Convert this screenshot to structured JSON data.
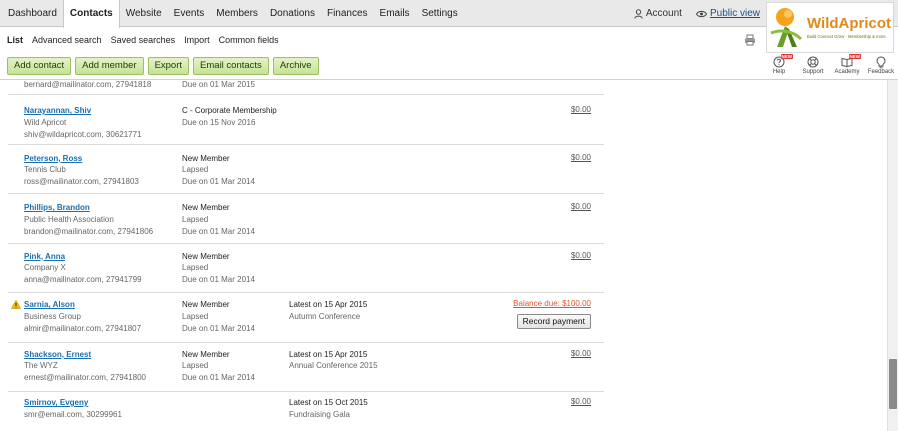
{
  "nav": {
    "tabs": [
      "Dashboard",
      "Contacts",
      "Website",
      "Events",
      "Members",
      "Donations",
      "Finances",
      "Emails",
      "Settings"
    ],
    "active_tab": "Contacts",
    "account_label": "Account",
    "public_view_label": "Public view"
  },
  "subnav": {
    "items": [
      "List",
      "Advanced search",
      "Saved searches",
      "Import",
      "Common fields"
    ],
    "active": "List"
  },
  "toolbar": {
    "buttons": [
      "Add contact",
      "Add member",
      "Export",
      "Email contacts",
      "Archive"
    ]
  },
  "logo": {
    "brand": "WildApricot",
    "tagline": "Build Connect Grow · Membership & more"
  },
  "help": {
    "items": [
      {
        "label": "Help",
        "icon": "help-icon",
        "new": true,
        "new_label": "NEW"
      },
      {
        "label": "Support",
        "icon": "support-icon",
        "new": false
      },
      {
        "label": "Academy",
        "icon": "academy-icon",
        "new": true,
        "new_label": "NEW"
      },
      {
        "label": "Feedback",
        "icon": "feedback-icon",
        "new": false
      }
    ]
  },
  "contacts": {
    "partial_row": {
      "line": "bernard@mailinator.com, 27941818",
      "due": "Due on 01 Mar 2015"
    },
    "rows": [
      {
        "name": "Narayannan, Shiv",
        "org": "Wild Apricot",
        "contact": "shiv@wildapricot.com, 30621771",
        "level": "C - Corporate Membership",
        "status": "",
        "due": "Due on 15 Nov 2016",
        "event_date": "",
        "event_name": "",
        "amount": "$0.00",
        "balance": false,
        "warning": false
      },
      {
        "name": "Peterson, Ross",
        "org": "Tennis Club",
        "contact": "ross@mailinator.com, 27941803",
        "level": "New Member",
        "status": "Lapsed",
        "due": "Due on 01 Mar 2014",
        "event_date": "",
        "event_name": "",
        "amount": "$0.00",
        "balance": false,
        "warning": false
      },
      {
        "name": "Phillips, Brandon",
        "org": "Public Health Association",
        "contact": "brandon@mailinator.com, 27941806",
        "level": "New Member",
        "status": "Lapsed",
        "due": "Due on 01 Mar 2014",
        "event_date": "",
        "event_name": "",
        "amount": "$0.00",
        "balance": false,
        "warning": false
      },
      {
        "name": "Pink, Anna",
        "org": "Company X",
        "contact": "anna@mailinator.com, 27941799",
        "level": "New Member",
        "status": "Lapsed",
        "due": "Due on 01 Mar 2014",
        "event_date": "",
        "event_name": "",
        "amount": "$0.00",
        "balance": false,
        "warning": false
      },
      {
        "name": "Sarnia, Alson",
        "org": "Business Group",
        "contact": "almir@mailinator.com, 27941807",
        "level": "New Member",
        "status": "Lapsed",
        "due": "Due on 01 Mar 2014",
        "event_date": "Latest on 15 Apr 2015",
        "event_name": "Autumn Conference",
        "amount": "Balance due: $100.00",
        "balance": true,
        "warning": true,
        "action": "Record payment"
      },
      {
        "name": "Shackson, Ernest",
        "org": "The WYZ",
        "contact": "ernest@mailinator.com, 27941800",
        "level": "New Member",
        "status": "Lapsed",
        "due": "Due on 01 Mar 2014",
        "event_date": "Latest on 15 Apr 2015",
        "event_name": "Annual Conference 2015",
        "amount": "$0.00",
        "balance": false,
        "warning": false
      },
      {
        "name": "Smirnov, Evgeny",
        "org": "",
        "contact": "smr@email.com, 30299961",
        "level": "",
        "status": "",
        "due": "",
        "event_date": "Latest on 15 Oct 2015",
        "event_name": "Fundraising Gala",
        "amount": "$0.00",
        "balance": false,
        "warning": false
      }
    ]
  },
  "colors": {
    "link": "#1b6fae",
    "button_green": "#c5e296",
    "balance_orange": "#e0542b",
    "nav_bg": "#e9e9e9"
  }
}
